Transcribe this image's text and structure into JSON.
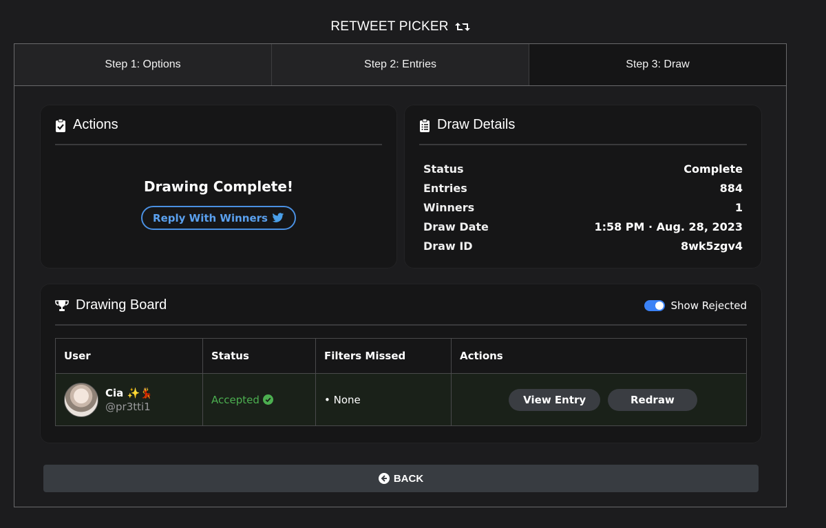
{
  "app": {
    "title": "RETWEET PICKER"
  },
  "tabs": [
    {
      "label": "Step 1: Options"
    },
    {
      "label": "Step 2: Entries"
    },
    {
      "label": "Step 3: Draw"
    }
  ],
  "actions": {
    "title": "Actions",
    "status_message": "Drawing Complete!",
    "reply_button": "Reply With Winners"
  },
  "draw_details": {
    "title": "Draw Details",
    "rows": [
      {
        "key": "Status",
        "value": "Complete"
      },
      {
        "key": "Entries",
        "value": "884"
      },
      {
        "key": "Winners",
        "value": "1"
      },
      {
        "key": "Draw Date",
        "value": "1:58 PM · Aug. 28, 2023"
      },
      {
        "key": "Draw ID",
        "value": "8wk5zgv4"
      }
    ]
  },
  "board": {
    "title": "Drawing Board",
    "toggle_label": "Show Rejected",
    "toggle_on": true,
    "columns": [
      "User",
      "Status",
      "Filters Missed",
      "Actions"
    ],
    "rows": [
      {
        "name": "Cia ✨💃",
        "handle": "@pr3tti1",
        "status": "Accepted",
        "filters": "• None",
        "view_label": "View Entry",
        "redraw_label": "Redraw"
      }
    ]
  },
  "back_button": "BACK",
  "colors": {
    "accent": "#4a90e2",
    "accepted": "#4caf50",
    "background": "#1c1c1e"
  }
}
